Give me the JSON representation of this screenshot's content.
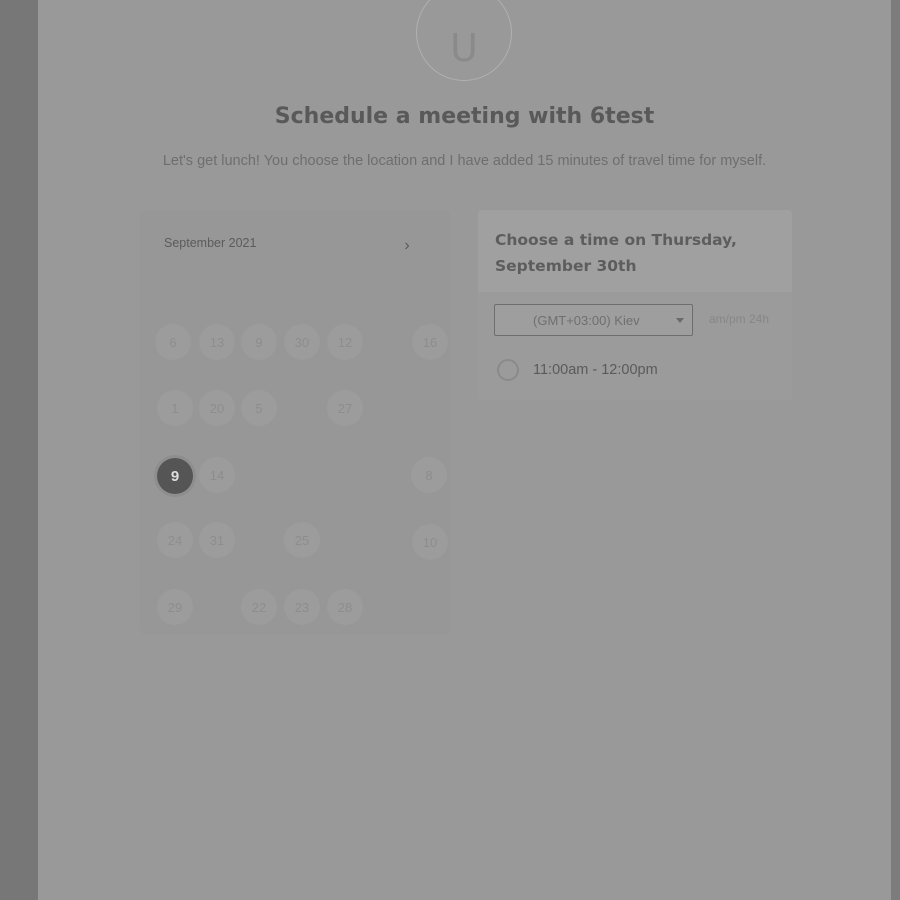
{
  "header": {
    "avatar_initial": "U",
    "title": "Schedule a meeting with 6test",
    "subtitle": "Let's get lunch! You choose the location and I have added 15 minutes of travel time for myself."
  },
  "calendar": {
    "month_label": "September 2021",
    "next_icon": "chevron-right-icon",
    "weekdays": [
      "",
      "",
      "",
      "",
      "",
      "",
      ""
    ],
    "days": [
      {
        "label": "6",
        "state": "available"
      },
      {
        "label": "13",
        "state": "available"
      },
      {
        "label": "9",
        "state": "available"
      },
      {
        "label": "30",
        "state": "available"
      },
      {
        "label": "12",
        "state": "available"
      },
      {
        "label": "16",
        "state": "available"
      },
      {
        "label": "1",
        "state": "available"
      },
      {
        "label": "20",
        "state": "available"
      },
      {
        "label": "5",
        "state": "available"
      },
      {
        "label": "27",
        "state": "available"
      },
      {
        "label": "9",
        "state": "selected"
      },
      {
        "label": "14",
        "state": "available"
      },
      {
        "label": "8",
        "state": "available"
      },
      {
        "label": "24",
        "state": "available"
      },
      {
        "label": "31",
        "state": "available"
      },
      {
        "label": "25",
        "state": "available"
      },
      {
        "label": "10",
        "state": "available"
      },
      {
        "label": "29",
        "state": "available"
      },
      {
        "label": "22",
        "state": "available"
      },
      {
        "label": "23",
        "state": "available"
      },
      {
        "label": "28",
        "state": "available"
      }
    ]
  },
  "times": {
    "heading": "Choose a time on Thursday, September 30th",
    "timezone_value": "(GMT+03:00) Kiev",
    "format_toggle": "am/pm  24h",
    "slots": [
      {
        "label": "11:00am - 12:00pm"
      }
    ]
  },
  "colors": {
    "overlay_gray": "#999999",
    "selected_day": "#555555"
  }
}
